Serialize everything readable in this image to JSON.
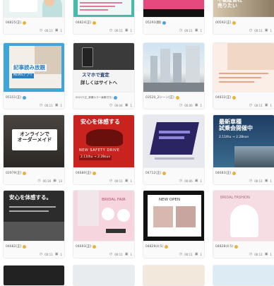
{
  "cards": [
    {
      "id": "04825(正)",
      "views": "00:11",
      "count": "1",
      "dot": "#e8b33a"
    },
    {
      "id": "04824(正)",
      "views": "00:11",
      "count": "1",
      "dot": "#e8b33a"
    },
    {
      "id": "05293(翻)",
      "views": "00:11",
      "count": "1",
      "dot": "#4aa3df"
    },
    {
      "id": "00592(正)",
      "views": "00:11",
      "count": "1",
      "dot": "#e8b33a"
    },
    {
      "id": "05151(正)",
      "views": "00:11",
      "count": "1",
      "dot": "#4aa3df"
    },
    {
      "id": "03217(正_実績カラー画像付き)",
      "views": "00:04",
      "count": "1",
      "dot": "#4aa3df"
    },
    {
      "id": "03520_2シーン(正)",
      "views": "00:06",
      "count": "1",
      "dot": "#e8b33a"
    },
    {
      "id": "04832(正)",
      "views": "00:11",
      "count": "1",
      "dot": "#e8b33a"
    },
    {
      "id": "02979(正)",
      "views": "00:30",
      "count": "13",
      "dot": "#e8b33a"
    },
    {
      "id": "04680(正)",
      "views": "00:11",
      "count": "1",
      "dot": "#e8b33a"
    },
    {
      "id": "04712(正)",
      "views": "00:06",
      "count": "1",
      "dot": "#e8b33a"
    },
    {
      "id": "04683(正)",
      "views": "00:11",
      "count": "1",
      "dot": "#e8b33a"
    },
    {
      "id": "04682(正)",
      "views": "00:11",
      "count": "1",
      "dot": "#e8b33a"
    },
    {
      "id": "04693(正)",
      "views": "00:11",
      "count": "1",
      "dot": "#e8b33a"
    },
    {
      "id": "04829(4:5)",
      "views": "00:11",
      "count": "1",
      "dot": "#e8b33a"
    },
    {
      "id": "04828(4:5)",
      "views": "00:11",
      "count": "1",
      "dot": "#e8b33a"
    }
  ],
  "texts": {
    "c3": "不動産会社\n売りたい",
    "c5_title": "記事読み放題",
    "c5_sub": "NEWSアプリ",
    "c6_top": "スマホで査定",
    "c6_mid": "詳しくはサイトへ",
    "c9": "オンラインで\nオーダーメイド",
    "c10_top": "安心を体感する",
    "c10_band": "NEW SAFETY DRIVE",
    "c10_date": "2.11thu → 2.28sun",
    "c12_top": "最新車種\n試乗会開催中",
    "c12_date": "2.11thu → 2.28sun",
    "c13_top": "安心を体感する。",
    "c14_top": "BRIDAL FAIR",
    "c15_top": "NEW OPEN",
    "c16_top": "BRIDAL FASHION"
  }
}
